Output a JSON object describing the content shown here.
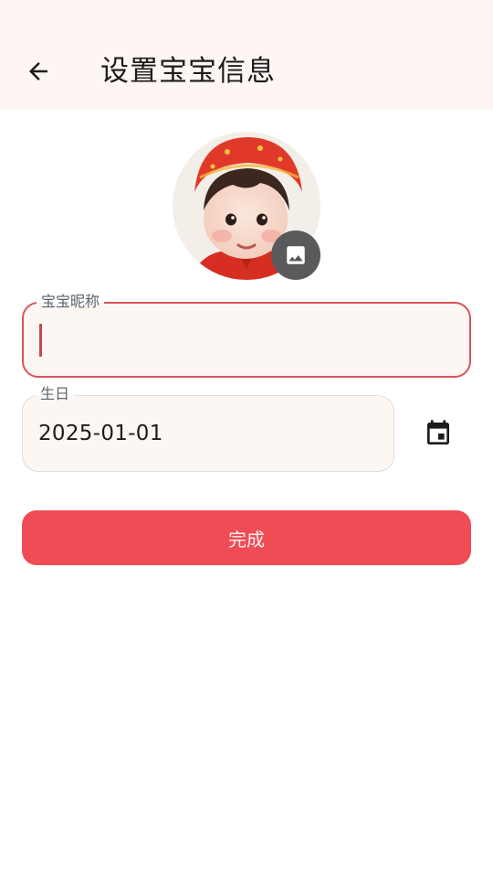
{
  "header": {
    "title": "设置宝宝信息",
    "back_icon": "arrow-left-icon"
  },
  "avatar": {
    "edit_icon": "image-icon"
  },
  "nickname": {
    "label": "宝宝昵称",
    "value": ""
  },
  "birthday": {
    "label": "生日",
    "value": "2025-01-01",
    "picker_icon": "calendar-icon"
  },
  "actions": {
    "done_label": "完成"
  },
  "colors": {
    "app_bar_bg": "#fdf6f2",
    "accent": "#ef4c55",
    "focus_border": "#d9545a",
    "field_bg": "#fdf7f3"
  }
}
